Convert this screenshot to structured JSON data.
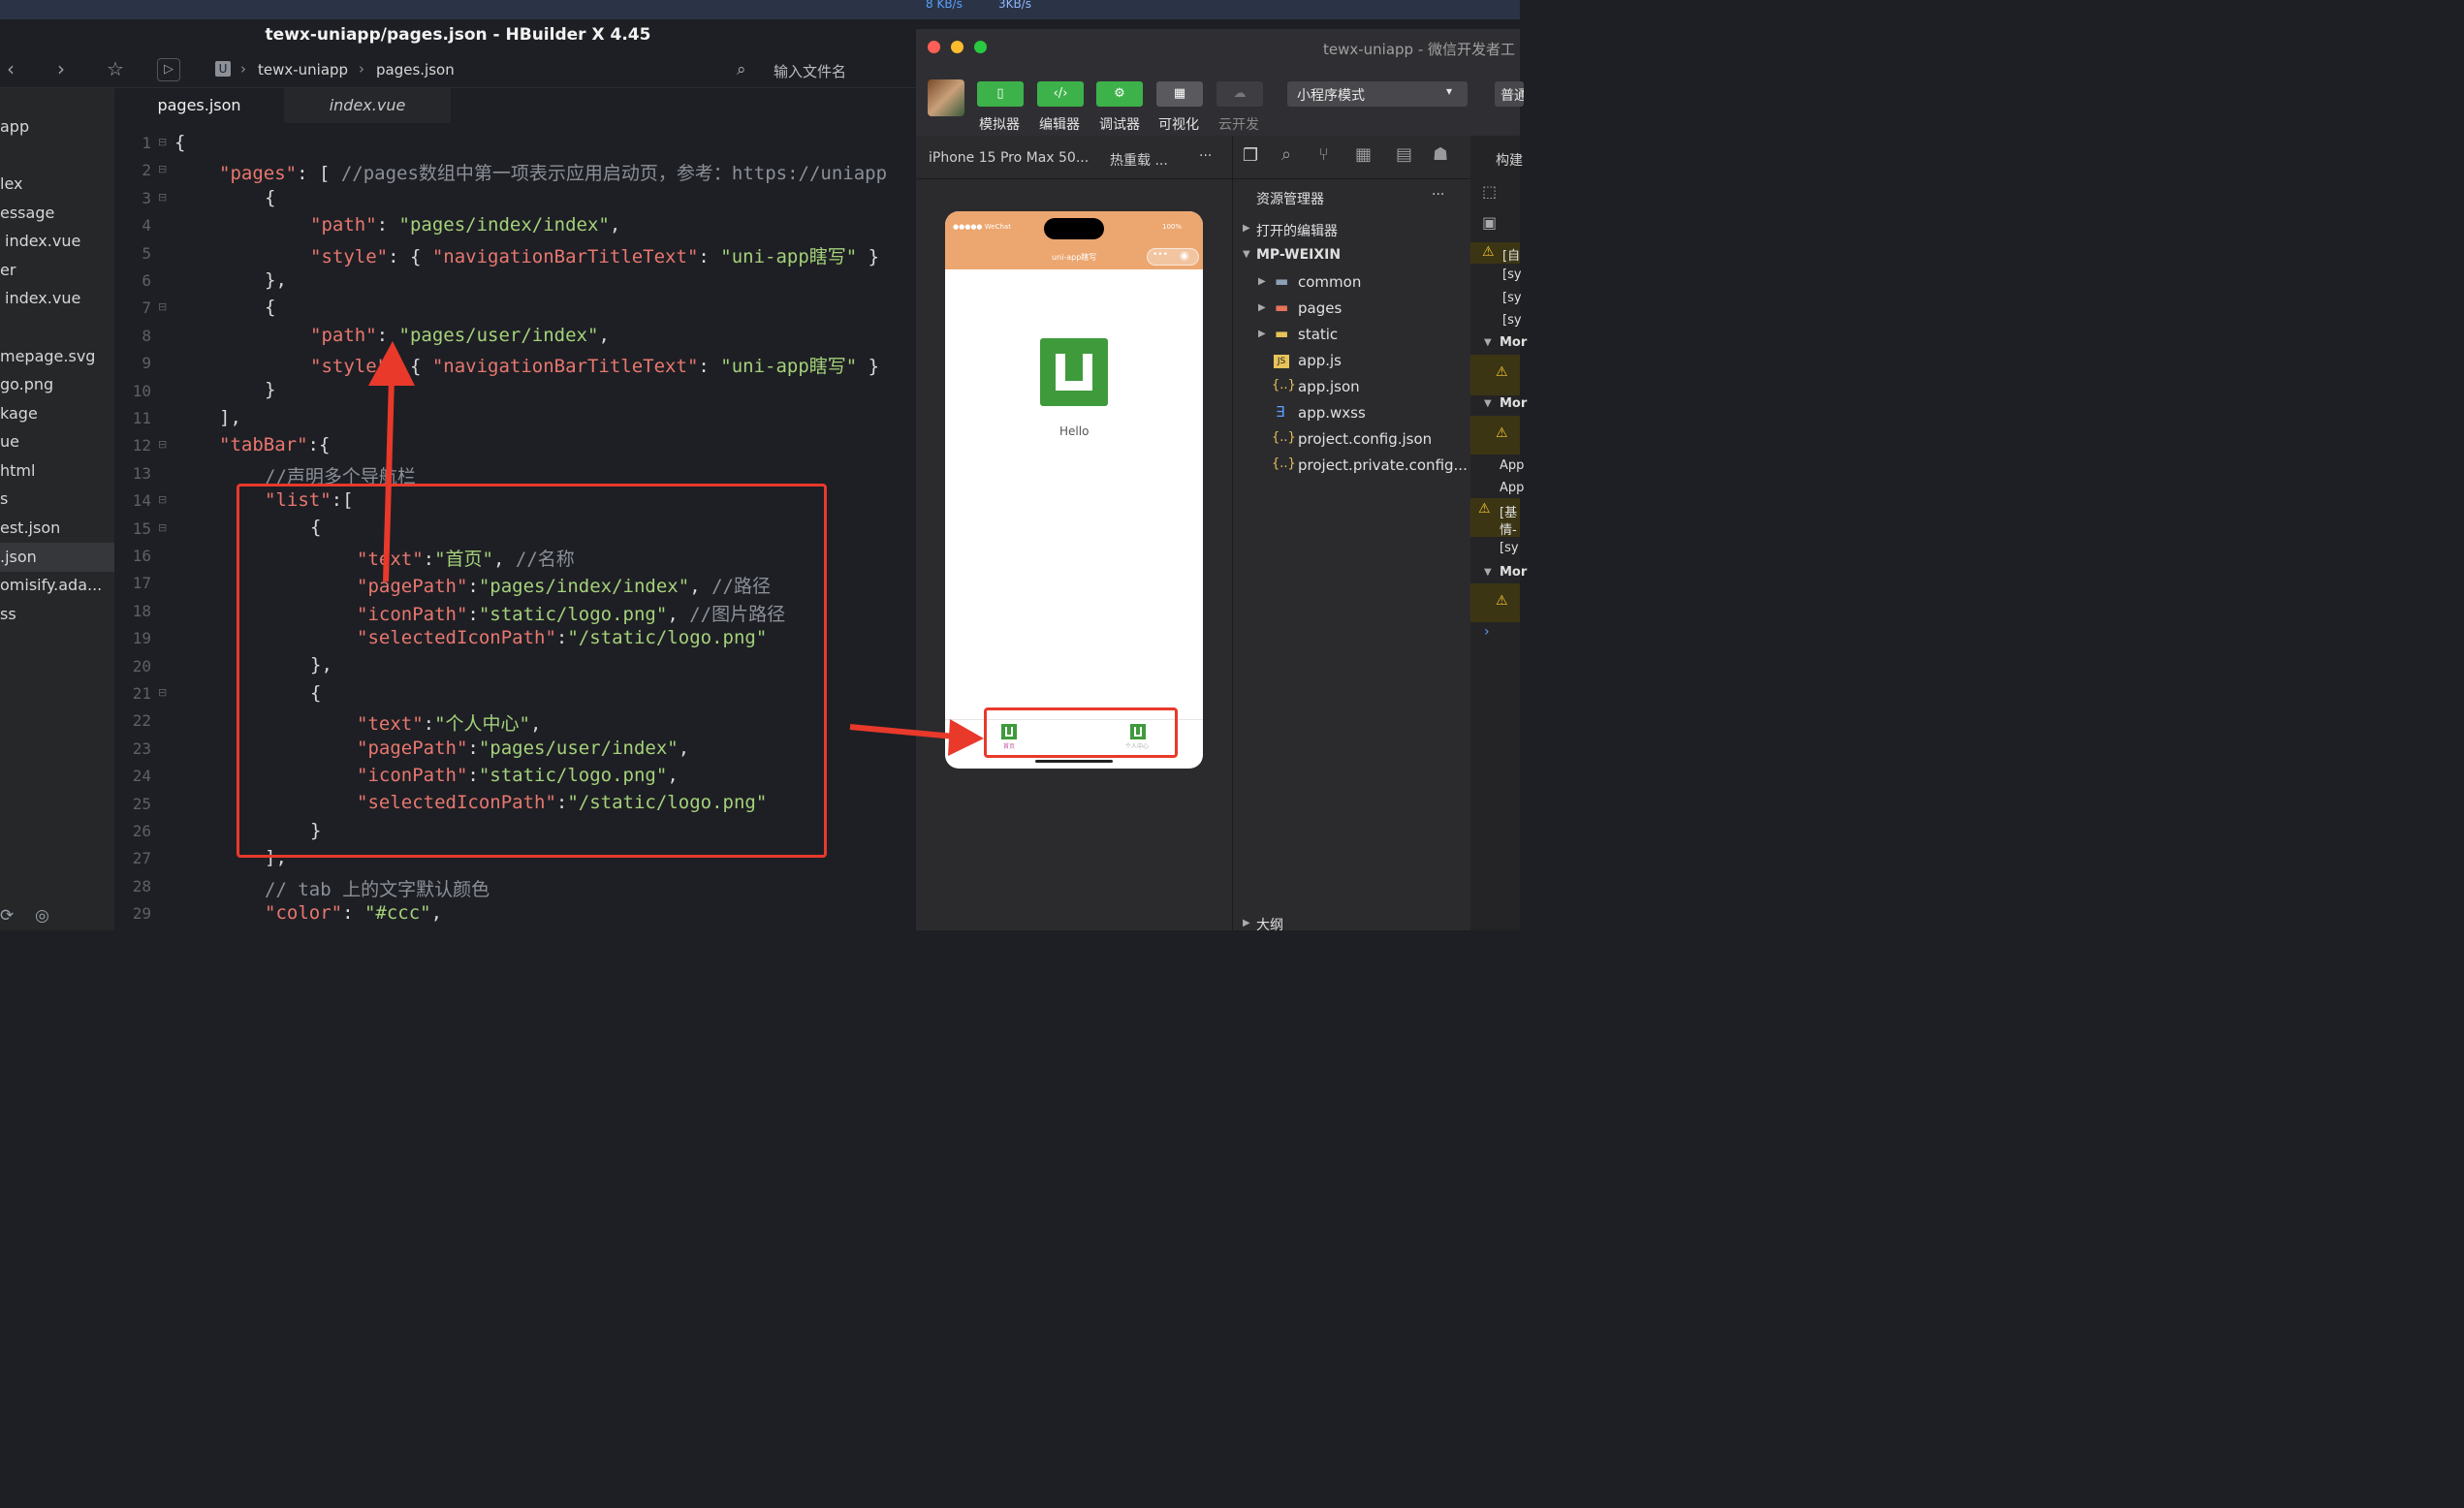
{
  "menubar": {
    "net_up": "3KB/s",
    "net_down": "8 KB/s"
  },
  "hbuilder": {
    "window_title": "tewx-uniapp/pages.json - HBuilder X 4.45",
    "breadcrumb": [
      "tewx-uniapp",
      "pages.json"
    ],
    "file_search_placeholder": "输入文件名",
    "tabs": [
      {
        "label": "pages.json",
        "active": true
      },
      {
        "label": "index.vue",
        "active": false
      }
    ],
    "sidebar_items": [
      "app",
      "lex",
      "essage",
      "index.vue",
      "er",
      "index.vue",
      "mepage.svg",
      "go.png",
      "kage",
      "ue",
      "html",
      "s",
      "est.json",
      ".json",
      "omisify.ada...",
      "ss"
    ],
    "line_numbers": [
      "1",
      "2",
      "3",
      "4",
      "5",
      "6",
      "7",
      "8",
      "9",
      "10",
      "11",
      "12",
      "13",
      "14",
      "15",
      "16",
      "17",
      "18",
      "19",
      "20",
      "21",
      "22",
      "23",
      "24",
      "25",
      "26",
      "27",
      "28",
      "29"
    ],
    "code": {
      "l1": "{",
      "l2_key": "\"pages\"",
      "l2_rest": ": [ ",
      "l2_comment": "//pages数组中第一项表示应用启动页，参考：https://uniapp",
      "l3": "{",
      "l4_key": "\"path\"",
      "l4_val": "\"pages/index/index\"",
      "l5_key": "\"style\"",
      "l5_inner_key": "\"navigationBarTitleText\"",
      "l5_inner_val": "\"uni-app瞎写\"",
      "l6": "},",
      "l7": "{",
      "l8_key": "\"path\"",
      "l8_val": "\"pages/user/index\"",
      "l9_key": "\"style\"",
      "l9_inner_key": "\"navigationBarTitleText\"",
      "l9_inner_val": "\"uni-app瞎写\"",
      "l10": "}",
      "l11": "],",
      "l12_key": "\"tabBar\"",
      "l12_rest": ":{",
      "l13": "//声明多个导航栏",
      "l14_key": "\"list\"",
      "l14_rest": ":[",
      "l15": "{",
      "l16_key": "\"text\"",
      "l16_val": "\"首页\"",
      "l16_comment": "//名称",
      "l17_key": "\"pagePath\"",
      "l17_val": "\"pages/index/index\"",
      "l17_comment": "//路径",
      "l18_key": "\"iconPath\"",
      "l18_val": "\"static/logo.png\"",
      "l18_comment": "//图片路径",
      "l19_key": "\"selectedIconPath\"",
      "l19_val": "\"/static/logo.png\"",
      "l20": "},",
      "l21": "{",
      "l22_key": "\"text\"",
      "l22_val": "\"个人中心\"",
      "l23_key": "\"pagePath\"",
      "l23_val": "\"pages/user/index\"",
      "l24_key": "\"iconPath\"",
      "l24_val": "\"static/logo.png\"",
      "l25_key": "\"selectedIconPath\"",
      "l25_val": "\"/static/logo.png\"",
      "l26": "}",
      "l27": "],",
      "l28": "// tab 上的文字默认颜色",
      "l29_key": "\"color\"",
      "l29_val": "\"#ccc\""
    }
  },
  "wechat": {
    "window_title": "tewx-uniapp - 微信开发者工",
    "toolbar": [
      {
        "label": "模拟器"
      },
      {
        "label": "编辑器"
      },
      {
        "label": "调试器"
      },
      {
        "label": "可视化"
      },
      {
        "label": "云开发"
      }
    ],
    "mode_select": "小程序模式",
    "compile_btn": "普通",
    "device": "iPhone 15 Pro Max 50...",
    "hot_reload": "热重载 ...",
    "more": "···",
    "phone": {
      "status_left": "●●●●● WeChat",
      "status_right": "100%",
      "nav_title": "uni-app瞎写",
      "hello": "Hello",
      "tab1": "首页",
      "tab2": "个人中心"
    },
    "explorer": {
      "title": "资源管理器",
      "more": "···",
      "open_editors": "打开的编辑器",
      "project": "MP-WEIXIN",
      "items": [
        "common",
        "pages",
        "static",
        "app.js",
        "app.json",
        "app.wxss",
        "project.config.json",
        "project.private.config..."
      ],
      "outline": "大纲"
    },
    "console_tab": "构建",
    "console_lines": [
      "[自",
      "[sy",
      "[sy",
      "[sy",
      "Mor",
      "Mor",
      "App",
      "App",
      "[基",
      "情-",
      "[sy",
      "Mor"
    ]
  },
  "colors": {
    "accent_green": "#3db24a",
    "annotation_red": "#e8392b",
    "phone_nav": "#eca66f"
  }
}
